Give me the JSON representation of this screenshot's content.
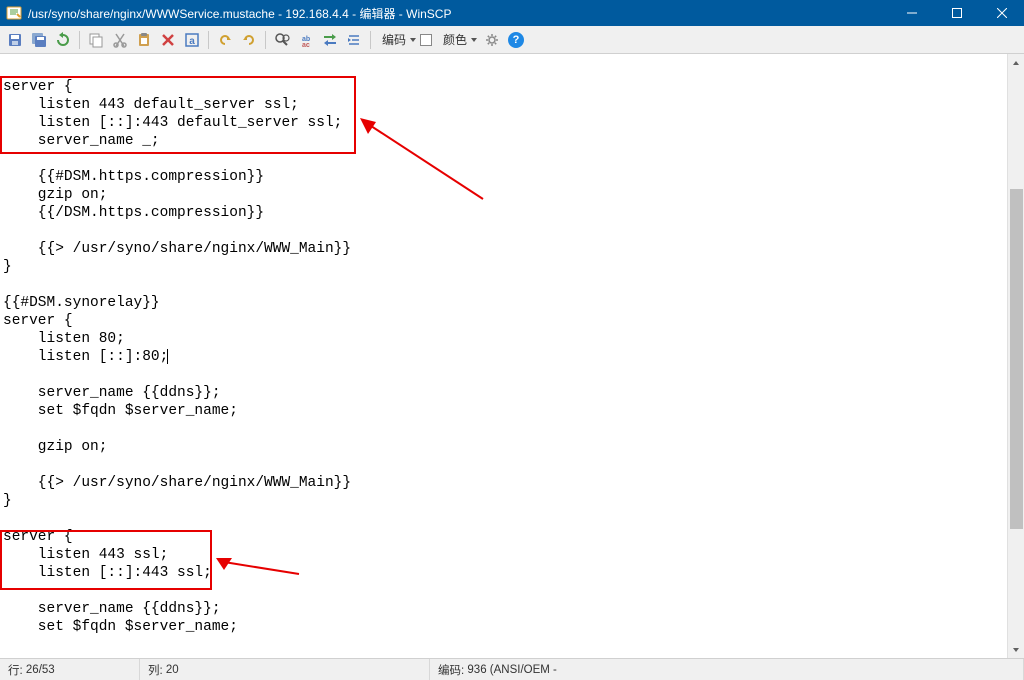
{
  "title": "/usr/syno/share/nginx/WWWService.mustache - 192.168.4.4 - 编辑器 - WinSCP",
  "toolbar": {
    "encoding_label": "编码",
    "color_label": "颜色"
  },
  "code": {
    "l1": "server {",
    "l2": "    listen 443 default_server ssl;",
    "l3": "    listen [::]:443 default_server ssl;",
    "l4": "    server_name _;",
    "l5": "",
    "l6": "    {{#DSM.https.compression}}",
    "l7": "    gzip on;",
    "l8": "    {{/DSM.https.compression}}",
    "l9": "",
    "l10": "    {{> /usr/syno/share/nginx/WWW_Main}}",
    "l11": "}",
    "l12": "",
    "l13": "{{#DSM.synorelay}}",
    "l14": "server {",
    "l15": "    listen 80;",
    "l16_a": "    listen [::]:80;",
    "l16_b": "",
    "l17": "",
    "l18": "    server_name {{ddns}};",
    "l19": "    set $fqdn $server_name;",
    "l20": "",
    "l21": "    gzip on;",
    "l22": "",
    "l23": "    {{> /usr/syno/share/nginx/WWW_Main}}",
    "l24": "}",
    "l25": "",
    "l26": "server {",
    "l27": "    listen 443 ssl;",
    "l28": "    listen [::]:443 ssl;",
    "l29": "",
    "l30": "    server_name {{ddns}};",
    "l31": "    set $fqdn $server_name;"
  },
  "status": {
    "line_label": "行:",
    "line_value": "26/53",
    "col_label": "列:",
    "col_value": "20",
    "encoding_label": "编码:",
    "encoding_value": "936 (ANSI/OEM -"
  }
}
